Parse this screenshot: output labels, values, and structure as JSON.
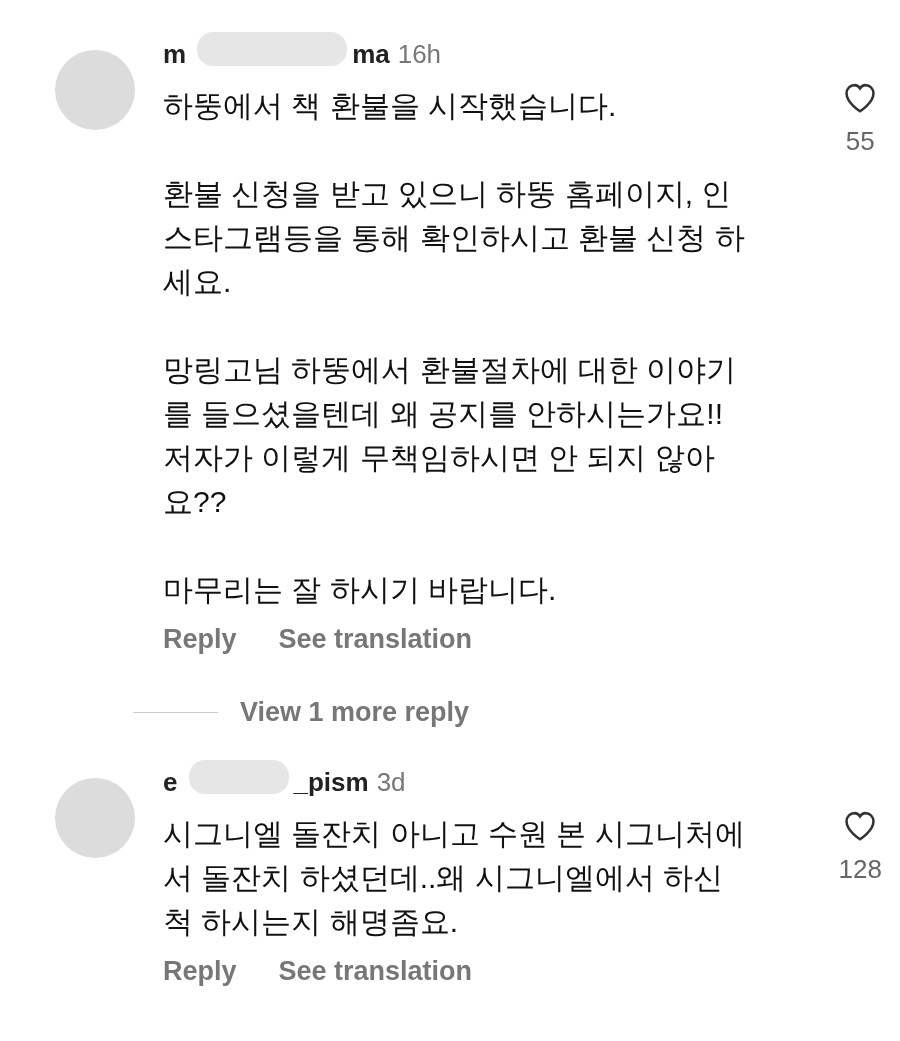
{
  "comments": [
    {
      "username_start": "m",
      "username_end": "ma",
      "time": "16h",
      "paragraphs": [
        "하뚱에서 책 환불을 시작했습니다.",
        "환불 신청을 받고 있으니 하뚱 홈페이지, 인스타그램등을 통해 확인하시고 환불 신청 하세요.",
        "망링고님 하뚱에서 환불절차에 대한 이야기를 들으셨을텐데 왜 공지를 안하시는가요!! 저자가 이렇게 무책임하시면 안 되지 않아요??",
        "마무리는 잘 하시기 바랍니다."
      ],
      "likes": "55",
      "liked": false,
      "reply": "Reply",
      "translate": "See translation",
      "more_replies": "View 1 more reply"
    },
    {
      "username_start": "e",
      "username_end": "_pism",
      "time": "3d",
      "paragraphs": [
        "시그니엘 돌잔치 아니고 수원 본 시그니처에서 돌잔치 하셨던데..왜 시그니엘에서 하신척 하시는지 해명좀요."
      ],
      "likes": "128",
      "liked": false,
      "reply": "Reply",
      "translate": "See translation"
    }
  ]
}
